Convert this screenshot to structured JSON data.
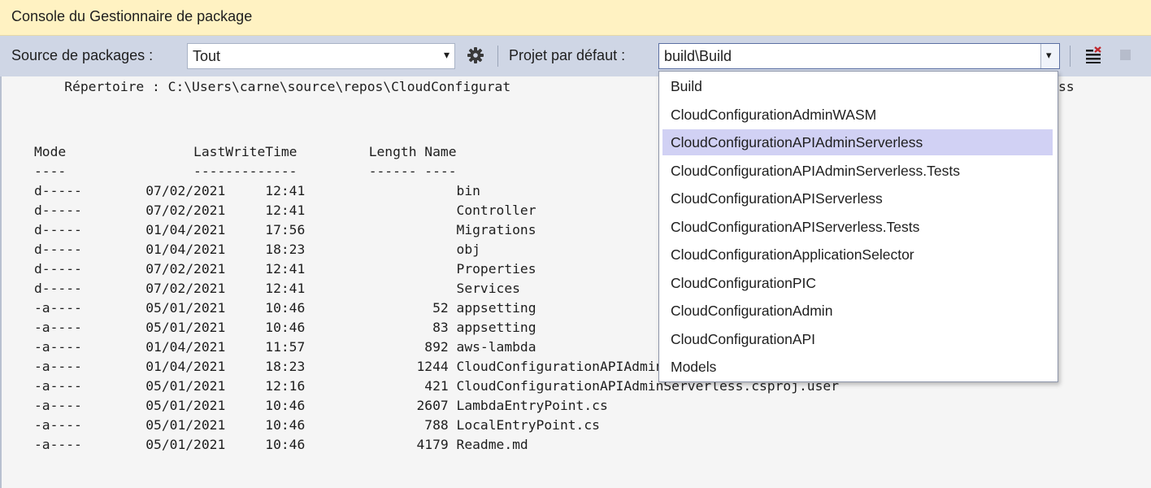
{
  "window": {
    "title": "Console du Gestionnaire de package"
  },
  "toolbar": {
    "source_label": "Source de packages :",
    "source_value": "Tout",
    "project_label": "Projet par défaut :",
    "project_value": "build\\Build",
    "icons": [
      "gear-icon",
      "clear-console-icon",
      "stop-icon"
    ]
  },
  "console": {
    "directory_line": "    Répertoire : C:\\Users\\carne\\source\\repos\\CloudConfigurat",
    "directory_tail": "ss",
    "header": "Mode                LastWriteTime         Length Name",
    "underline": "----                -------------         ------ ----",
    "rows": [
      {
        "mode": "d-----",
        "date": "07/02/2021",
        "time": "12:41",
        "length": "",
        "name": "bin"
      },
      {
        "mode": "d-----",
        "date": "07/02/2021",
        "time": "12:41",
        "length": "",
        "name": "Controller"
      },
      {
        "mode": "d-----",
        "date": "01/04/2021",
        "time": "17:56",
        "length": "",
        "name": "Migrations"
      },
      {
        "mode": "d-----",
        "date": "01/04/2021",
        "time": "18:23",
        "length": "",
        "name": "obj"
      },
      {
        "mode": "d-----",
        "date": "07/02/2021",
        "time": "12:41",
        "length": "",
        "name": "Properties"
      },
      {
        "mode": "d-----",
        "date": "07/02/2021",
        "time": "12:41",
        "length": "",
        "name": "Services"
      },
      {
        "mode": "-a----",
        "date": "05/01/2021",
        "time": "10:46",
        "length": "52",
        "name": "appsetting"
      },
      {
        "mode": "-a----",
        "date": "05/01/2021",
        "time": "10:46",
        "length": "83",
        "name": "appsetting"
      },
      {
        "mode": "-a----",
        "date": "01/04/2021",
        "time": "11:57",
        "length": "892",
        "name": "aws-lambda"
      },
      {
        "mode": "-a----",
        "date": "01/04/2021",
        "time": "18:23",
        "length": "1244",
        "name": "CloudConfigurationAPIAdminServerless.csproj"
      },
      {
        "mode": "-a----",
        "date": "05/01/2021",
        "time": "12:16",
        "length": "421",
        "name": "CloudConfigurationAPIAdminServerless.csproj.user"
      },
      {
        "mode": "-a----",
        "date": "05/01/2021",
        "time": "10:46",
        "length": "2607",
        "name": "LambdaEntryPoint.cs"
      },
      {
        "mode": "-a----",
        "date": "05/01/2021",
        "time": "10:46",
        "length": "788",
        "name": "LocalEntryPoint.cs"
      },
      {
        "mode": "-a----",
        "date": "05/01/2021",
        "time": "10:46",
        "length": "4179",
        "name": "Readme.md"
      }
    ]
  },
  "dropdown": {
    "selected_index": 2,
    "items": [
      "Build",
      "CloudConfigurationAdminWASM",
      "CloudConfigurationAPIAdminServerless",
      "CloudConfigurationAPIAdminServerless.Tests",
      "CloudConfigurationAPIServerless",
      "CloudConfigurationAPIServerless.Tests",
      "CloudConfigurationApplicationSelector",
      "CloudConfigurationPIC",
      "CloudConfigurationAdmin",
      "CloudConfigurationAPI",
      "Models"
    ]
  }
}
